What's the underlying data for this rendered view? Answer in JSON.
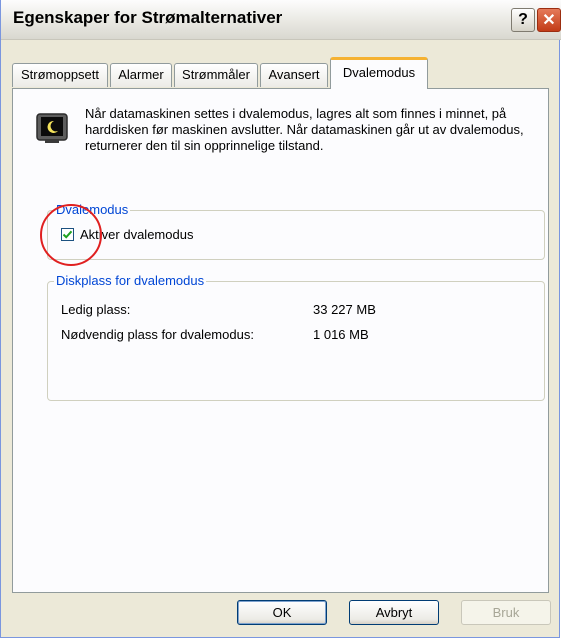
{
  "window": {
    "title": "Egenskaper for Strømalternativer"
  },
  "titlebar_buttons": {
    "help": "?",
    "close": "✕"
  },
  "tabs": [
    {
      "label": "Strømoppsett",
      "active": false
    },
    {
      "label": "Alarmer",
      "active": false
    },
    {
      "label": "Strømmåler",
      "active": false
    },
    {
      "label": "Avansert",
      "active": false
    },
    {
      "label": "Dvalemodus",
      "active": true
    }
  ],
  "info": {
    "icon": "hibernate-monitor-icon",
    "text": "Når datamaskinen settes i dvalemodus, lagres alt som finnes i minnet, på harddisken før maskinen avslutter. Når datamaskinen går ut av dvalemodus, returnerer den til sin opprinnelige tilstand."
  },
  "hibernate_group": {
    "title": "Dvalemodus",
    "checkbox_label": "Aktiver dvalemodus",
    "checked": true
  },
  "disk_group": {
    "title": "Diskplass for dvalemodus",
    "rows": [
      {
        "label": "Ledig plass:",
        "value": "33 227 MB"
      },
      {
        "label": "Nødvendig plass for dvalemodus:",
        "value": "1 016 MB"
      }
    ]
  },
  "buttons": {
    "ok": "OK",
    "cancel": "Avbryt",
    "apply": "Bruk"
  },
  "colors": {
    "accent_tab": "#f5b232",
    "group_title": "#0046d5",
    "annotation": "#e02020"
  }
}
